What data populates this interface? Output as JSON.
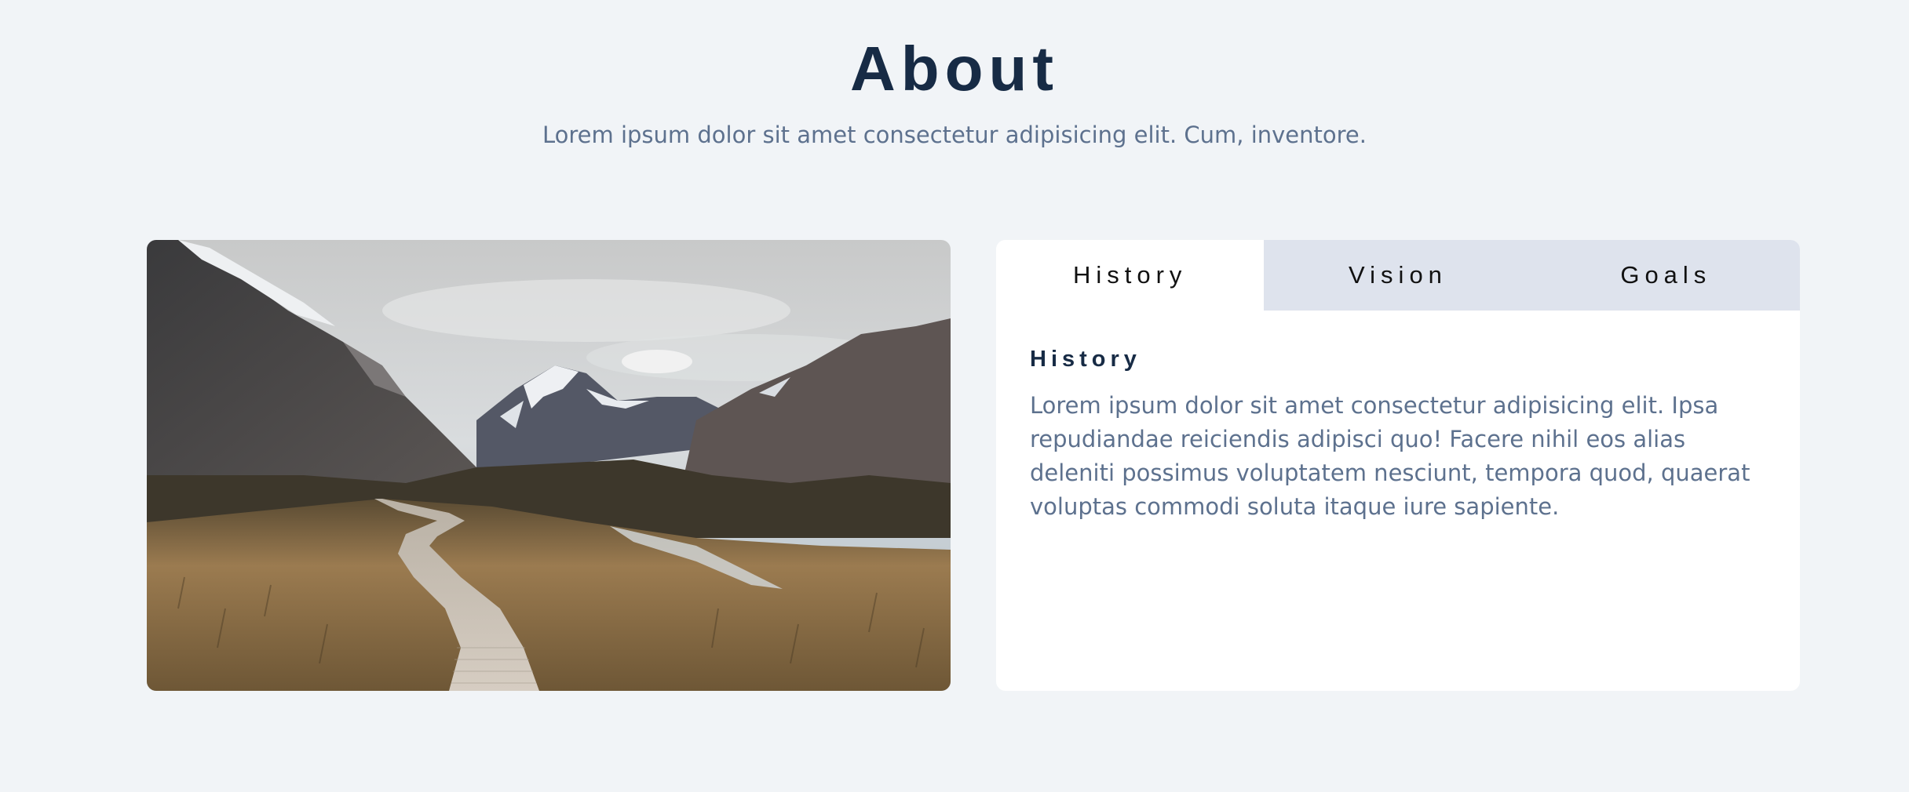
{
  "header": {
    "title": "About",
    "subtitle": "Lorem ipsum dolor sit amet consectetur adipisicing elit. Cum, inventore."
  },
  "image": {
    "alt": "Mountain valley with wooden boardwalk"
  },
  "tabs": [
    {
      "label": "History",
      "active": true
    },
    {
      "label": "Vision",
      "active": false
    },
    {
      "label": "Goals",
      "active": false
    }
  ],
  "content": {
    "heading": "History",
    "body": "Lorem ipsum dolor sit amet consectetur adipisicing elit. Ipsa repudiandae reiciendis adipisci quo! Facere nihil eos alias deleniti possimus voluptatem nesciunt, tempora quod, quaerat voluptas commodi soluta itaque iure sapiente."
  },
  "colors": {
    "background": "#f1f4f7",
    "title": "#172b45",
    "text_muted": "#5d718e",
    "tab_inactive": "#dee3ed",
    "card": "#ffffff"
  }
}
